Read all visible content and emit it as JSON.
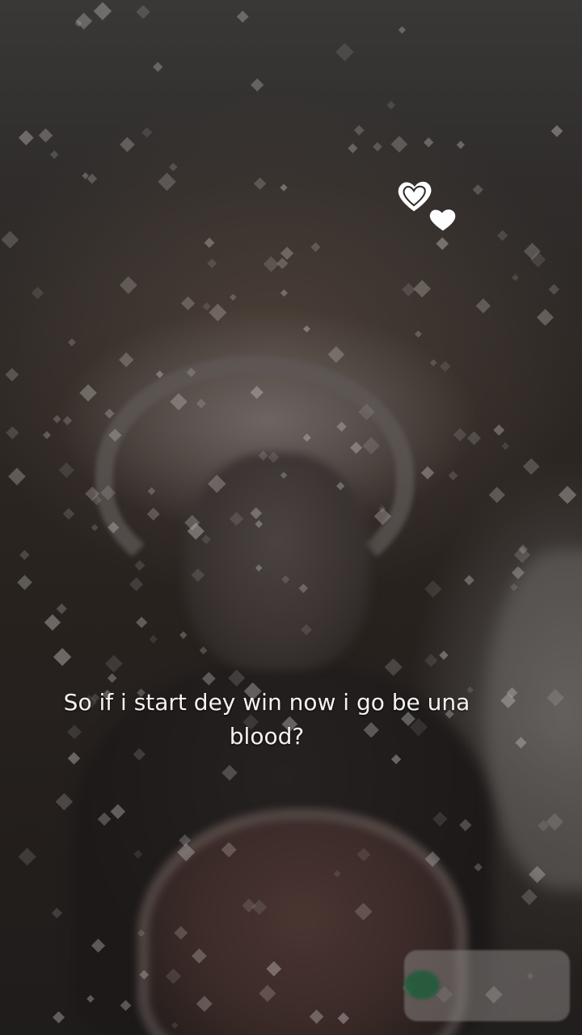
{
  "scene": {
    "hearts_icon": "double-heart-sticker",
    "sparkle_icon": "diamond-sparkle"
  },
  "caption": {
    "line1": "So if i start dey win now i go be una",
    "line2": "blood?"
  },
  "colors": {
    "caption_text": "#f5f3f1",
    "sparkle": "#cfcac6",
    "heart": "#ffffff"
  }
}
